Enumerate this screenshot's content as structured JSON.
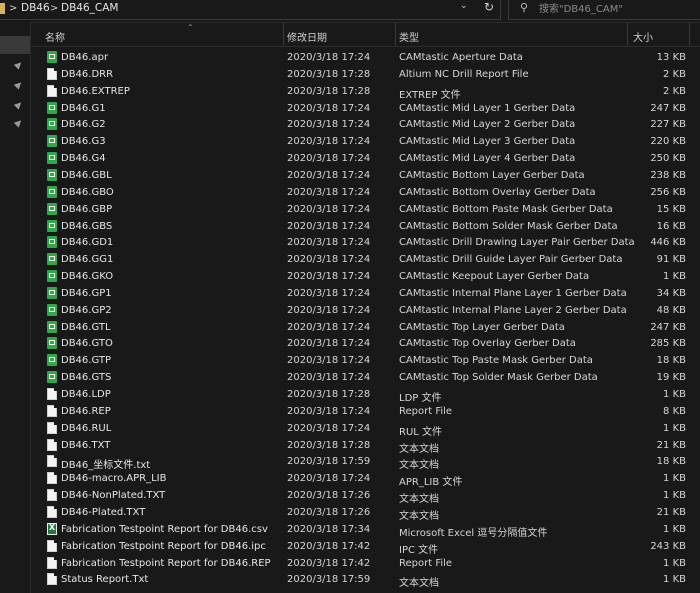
{
  "address": {
    "crumbs": [
      "DB46",
      "DB46_CAM"
    ],
    "separator": ">"
  },
  "search": {
    "placeholder": "搜索\"DB46_CAM\""
  },
  "columns": {
    "name": "名称",
    "date": "修改日期",
    "type": "类型",
    "size": "大小"
  },
  "colors": {
    "background": "#191919",
    "text": "#e6e6e6",
    "gerber_icon": "#2ea94a"
  },
  "files": [
    {
      "name": "DB46.apr",
      "date": "2020/3/18 17:24",
      "type": "CAMtastic Aperture Data",
      "size": "13 KB",
      "icon": "gerber"
    },
    {
      "name": "DB46.DRR",
      "date": "2020/3/18 17:28",
      "type": "Altium NC Drill Report File",
      "size": "2 KB",
      "icon": "doc"
    },
    {
      "name": "DB46.EXTREP",
      "date": "2020/3/18 17:28",
      "type": "EXTREP 文件",
      "size": "2 KB",
      "icon": "doc"
    },
    {
      "name": "DB46.G1",
      "date": "2020/3/18 17:24",
      "type": "CAMtastic Mid Layer 1 Gerber Data",
      "size": "247 KB",
      "icon": "gerber"
    },
    {
      "name": "DB46.G2",
      "date": "2020/3/18 17:24",
      "type": "CAMtastic Mid Layer 2 Gerber Data",
      "size": "227 KB",
      "icon": "gerber"
    },
    {
      "name": "DB46.G3",
      "date": "2020/3/18 17:24",
      "type": "CAMtastic Mid Layer 3 Gerber Data",
      "size": "220 KB",
      "icon": "gerber"
    },
    {
      "name": "DB46.G4",
      "date": "2020/3/18 17:24",
      "type": "CAMtastic Mid Layer 4 Gerber Data",
      "size": "250 KB",
      "icon": "gerber"
    },
    {
      "name": "DB46.GBL",
      "date": "2020/3/18 17:24",
      "type": "CAMtastic Bottom Layer Gerber Data",
      "size": "238 KB",
      "icon": "gerber"
    },
    {
      "name": "DB46.GBO",
      "date": "2020/3/18 17:24",
      "type": "CAMtastic Bottom Overlay Gerber Data",
      "size": "256 KB",
      "icon": "gerber"
    },
    {
      "name": "DB46.GBP",
      "date": "2020/3/18 17:24",
      "type": "CAMtastic Bottom Paste Mask Gerber Data",
      "size": "15 KB",
      "icon": "gerber"
    },
    {
      "name": "DB46.GBS",
      "date": "2020/3/18 17:24",
      "type": "CAMtastic Bottom Solder Mask Gerber Data",
      "size": "16 KB",
      "icon": "gerber"
    },
    {
      "name": "DB46.GD1",
      "date": "2020/3/18 17:24",
      "type": "CAMtastic Drill Drawing Layer Pair Gerber Data",
      "size": "446 KB",
      "icon": "gerber"
    },
    {
      "name": "DB46.GG1",
      "date": "2020/3/18 17:24",
      "type": "CAMtastic Drill Guide Layer Pair Gerber Data",
      "size": "91 KB",
      "icon": "gerber"
    },
    {
      "name": "DB46.GKO",
      "date": "2020/3/18 17:24",
      "type": "CAMtastic Keepout Layer Gerber Data",
      "size": "1 KB",
      "icon": "gerber"
    },
    {
      "name": "DB46.GP1",
      "date": "2020/3/18 17:24",
      "type": "CAMtastic Internal Plane Layer 1 Gerber Data",
      "size": "34 KB",
      "icon": "gerber"
    },
    {
      "name": "DB46.GP2",
      "date": "2020/3/18 17:24",
      "type": "CAMtastic Internal Plane Layer 2 Gerber Data",
      "size": "48 KB",
      "icon": "gerber"
    },
    {
      "name": "DB46.GTL",
      "date": "2020/3/18 17:24",
      "type": "CAMtastic Top Layer Gerber Data",
      "size": "247 KB",
      "icon": "gerber"
    },
    {
      "name": "DB46.GTO",
      "date": "2020/3/18 17:24",
      "type": "CAMtastic Top Overlay Gerber Data",
      "size": "285 KB",
      "icon": "gerber"
    },
    {
      "name": "DB46.GTP",
      "date": "2020/3/18 17:24",
      "type": "CAMtastic Top Paste Mask Gerber Data",
      "size": "18 KB",
      "icon": "gerber"
    },
    {
      "name": "DB46.GTS",
      "date": "2020/3/18 17:24",
      "type": "CAMtastic Top Solder Mask Gerber Data",
      "size": "19 KB",
      "icon": "gerber"
    },
    {
      "name": "DB46.LDP",
      "date": "2020/3/18 17:28",
      "type": "LDP 文件",
      "size": "1 KB",
      "icon": "doc"
    },
    {
      "name": "DB46.REP",
      "date": "2020/3/18 17:24",
      "type": "Report File",
      "size": "8 KB",
      "icon": "doc"
    },
    {
      "name": "DB46.RUL",
      "date": "2020/3/18 17:24",
      "type": "RUL 文件",
      "size": "1 KB",
      "icon": "doc"
    },
    {
      "name": "DB46.TXT",
      "date": "2020/3/18 17:28",
      "type": "文本文档",
      "size": "21 KB",
      "icon": "doc"
    },
    {
      "name": "DB46_坐标文件.txt",
      "date": "2020/3/18 17:59",
      "type": "文本文档",
      "size": "18 KB",
      "icon": "doc"
    },
    {
      "name": "DB46-macro.APR_LIB",
      "date": "2020/3/18 17:24",
      "type": "APR_LIB 文件",
      "size": "1 KB",
      "icon": "doc"
    },
    {
      "name": "DB46-NonPlated.TXT",
      "date": "2020/3/18 17:26",
      "type": "文本文档",
      "size": "1 KB",
      "icon": "doc"
    },
    {
      "name": "DB46-Plated.TXT",
      "date": "2020/3/18 17:26",
      "type": "文本文档",
      "size": "21 KB",
      "icon": "doc"
    },
    {
      "name": "Fabrication Testpoint Report for DB46.csv",
      "date": "2020/3/18 17:34",
      "type": "Microsoft Excel 逗号分隔值文件",
      "size": "1 KB",
      "icon": "excel"
    },
    {
      "name": "Fabrication Testpoint Report for DB46.ipc",
      "date": "2020/3/18 17:42",
      "type": "IPC 文件",
      "size": "243 KB",
      "icon": "doc"
    },
    {
      "name": "Fabrication Testpoint Report for DB46.REP",
      "date": "2020/3/18 17:42",
      "type": "Report File",
      "size": "1 KB",
      "icon": "doc"
    },
    {
      "name": "Status Report.Txt",
      "date": "2020/3/18 17:59",
      "type": "文本文档",
      "size": "1 KB",
      "icon": "doc"
    }
  ]
}
